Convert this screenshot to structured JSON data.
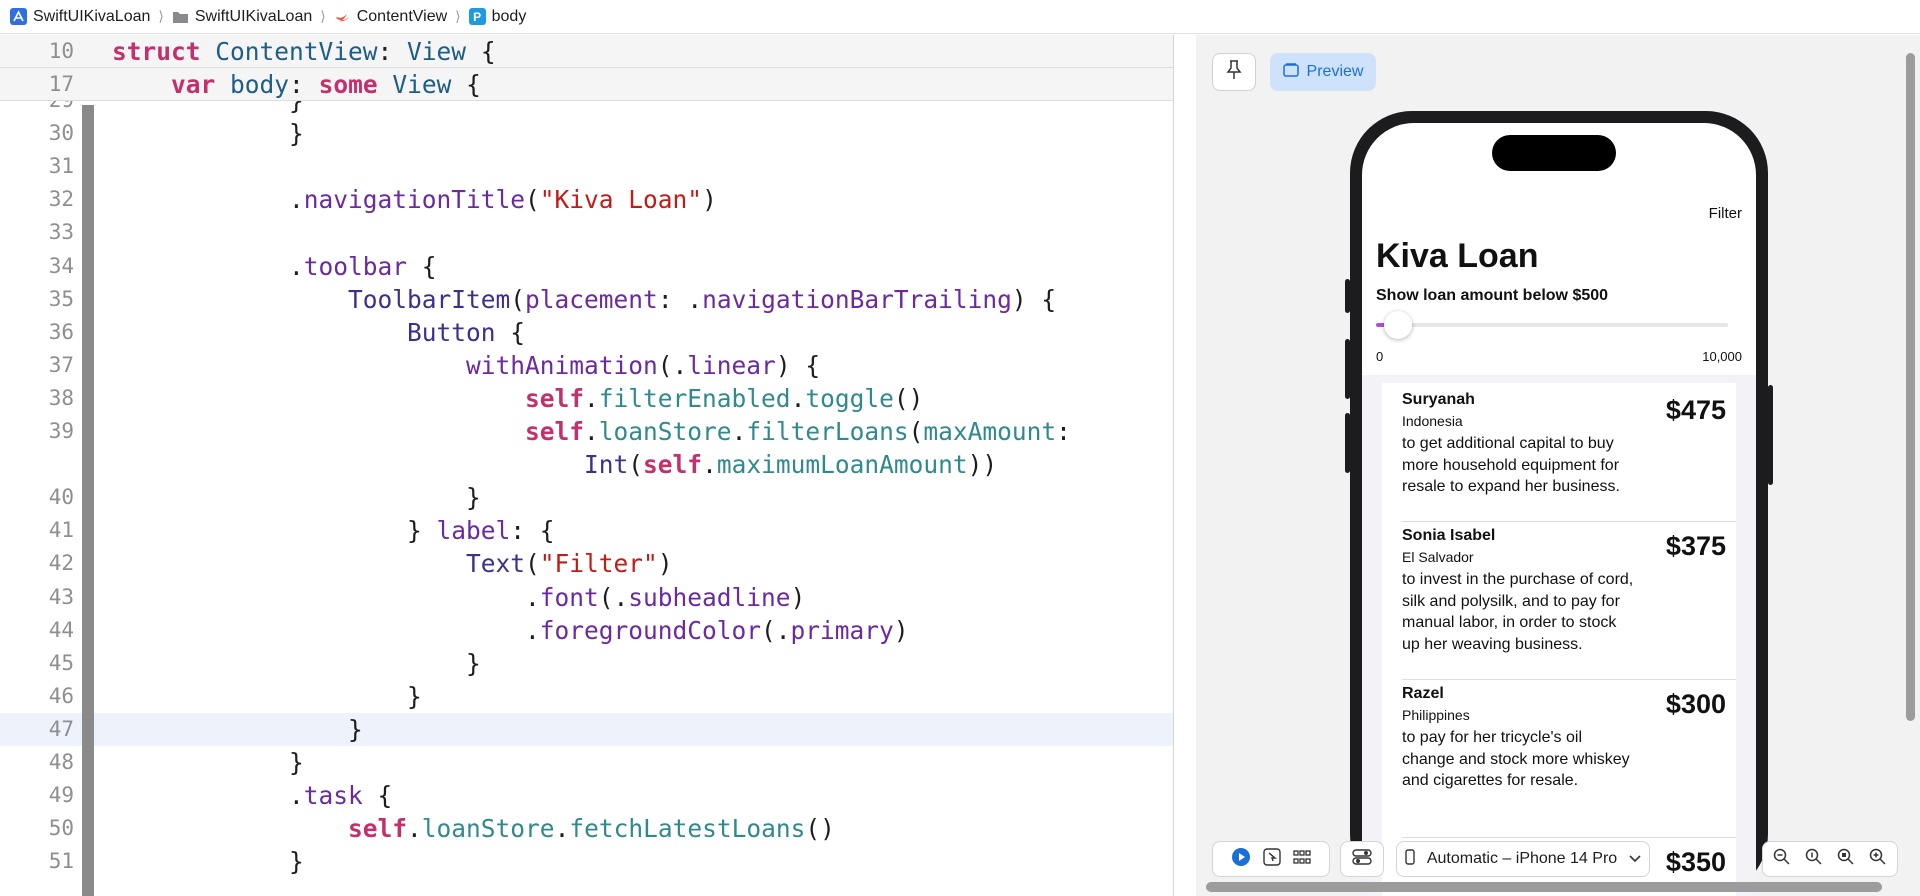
{
  "breadcrumb": {
    "project": "SwiftUIKivaLoan",
    "folder": "SwiftUIKivaLoan",
    "file": "ContentView",
    "symbol": "body",
    "symbol_badge": "P"
  },
  "editor": {
    "sticky_lines": [
      {
        "num": "10",
        "segments": [
          [
            "kw",
            "struct "
          ],
          [
            "ty",
            "ContentView"
          ],
          [
            "plain",
            ": "
          ],
          [
            "ty",
            "View"
          ],
          [
            "plain",
            " {"
          ]
        ]
      },
      {
        "num": "17",
        "segments": [
          [
            "plain",
            "    "
          ],
          [
            "kw",
            "var "
          ],
          [
            "ty",
            "body"
          ],
          [
            "plain",
            ": "
          ],
          [
            "kw",
            "some "
          ],
          [
            "ty",
            "View"
          ],
          [
            "plain",
            " {"
          ]
        ]
      }
    ],
    "lines": [
      {
        "num": "29",
        "segments": [
          [
            "plain",
            "            }"
          ]
        ]
      },
      {
        "num": "30",
        "segments": [
          [
            "plain",
            "            }"
          ]
        ]
      },
      {
        "num": "31",
        "segments": [
          [
            "plain",
            ""
          ]
        ]
      },
      {
        "num": "32",
        "segments": [
          [
            "plain",
            "            ."
          ],
          [
            "fn",
            "navigationTitle"
          ],
          [
            "plain",
            "("
          ],
          [
            "str",
            "\"Kiva Loan\""
          ],
          [
            "plain",
            ")"
          ]
        ]
      },
      {
        "num": "33",
        "segments": [
          [
            "plain",
            ""
          ]
        ]
      },
      {
        "num": "34",
        "segments": [
          [
            "plain",
            "            ."
          ],
          [
            "fn",
            "toolbar"
          ],
          [
            "plain",
            " {"
          ]
        ]
      },
      {
        "num": "35",
        "segments": [
          [
            "plain",
            "                "
          ],
          [
            "tyn",
            "ToolbarItem"
          ],
          [
            "plain",
            "("
          ],
          [
            "fn",
            "placement"
          ],
          [
            "plain",
            ": ."
          ],
          [
            "fn",
            "navigationBarTrailing"
          ],
          [
            "plain",
            ") {"
          ]
        ]
      },
      {
        "num": "36",
        "segments": [
          [
            "plain",
            "                    "
          ],
          [
            "tyn",
            "Button"
          ],
          [
            "plain",
            " {"
          ]
        ]
      },
      {
        "num": "37",
        "segments": [
          [
            "plain",
            "                        "
          ],
          [
            "fn",
            "withAnimation"
          ],
          [
            "plain",
            "(."
          ],
          [
            "fn",
            "linear"
          ],
          [
            "plain",
            ") {"
          ]
        ]
      },
      {
        "num": "38",
        "segments": [
          [
            "plain",
            "                            "
          ],
          [
            "kw",
            "self"
          ],
          [
            "plain",
            "."
          ],
          [
            "prop",
            "filterEnabled"
          ],
          [
            "plain",
            "."
          ],
          [
            "prop",
            "toggle"
          ],
          [
            "plain",
            "()"
          ]
        ]
      },
      {
        "num": "39",
        "segments": [
          [
            "plain",
            "                            "
          ],
          [
            "kw",
            "self"
          ],
          [
            "plain",
            "."
          ],
          [
            "prop",
            "loanStore"
          ],
          [
            "plain",
            "."
          ],
          [
            "prop",
            "filterLoans"
          ],
          [
            "plain",
            "("
          ],
          [
            "prop",
            "maxAmount"
          ],
          [
            "plain",
            ":"
          ]
        ]
      },
      {
        "num": "",
        "segments": [
          [
            "plain",
            "                                "
          ],
          [
            "tyn",
            "Int"
          ],
          [
            "plain",
            "("
          ],
          [
            "kw",
            "self"
          ],
          [
            "plain",
            "."
          ],
          [
            "prop",
            "maximumLoanAmount"
          ],
          [
            "plain",
            "))"
          ]
        ]
      },
      {
        "num": "40",
        "segments": [
          [
            "plain",
            "                        }"
          ]
        ]
      },
      {
        "num": "41",
        "segments": [
          [
            "plain",
            "                    } "
          ],
          [
            "fn",
            "label"
          ],
          [
            "plain",
            ": {"
          ]
        ]
      },
      {
        "num": "42",
        "segments": [
          [
            "plain",
            "                        "
          ],
          [
            "tyn",
            "Text"
          ],
          [
            "plain",
            "("
          ],
          [
            "str",
            "\"Filter\""
          ],
          [
            "plain",
            ")"
          ]
        ]
      },
      {
        "num": "43",
        "segments": [
          [
            "plain",
            "                            ."
          ],
          [
            "fn",
            "font"
          ],
          [
            "plain",
            "(."
          ],
          [
            "fn",
            "subheadline"
          ],
          [
            "plain",
            ")"
          ]
        ]
      },
      {
        "num": "44",
        "segments": [
          [
            "plain",
            "                            ."
          ],
          [
            "fn",
            "foregroundColor"
          ],
          [
            "plain",
            "(."
          ],
          [
            "fn",
            "primary"
          ],
          [
            "plain",
            ")"
          ]
        ]
      },
      {
        "num": "45",
        "segments": [
          [
            "plain",
            "                        }"
          ]
        ]
      },
      {
        "num": "46",
        "segments": [
          [
            "plain",
            "                    }"
          ]
        ]
      },
      {
        "num": "47",
        "segments": [
          [
            "plain",
            "                }"
          ]
        ],
        "highlight": true
      },
      {
        "num": "48",
        "segments": [
          [
            "plain",
            "            }"
          ]
        ]
      },
      {
        "num": "49",
        "segments": [
          [
            "plain",
            "            ."
          ],
          [
            "fn",
            "task"
          ],
          [
            "plain",
            " {"
          ]
        ]
      },
      {
        "num": "50",
        "segments": [
          [
            "plain",
            "                "
          ],
          [
            "kw",
            "self"
          ],
          [
            "plain",
            "."
          ],
          [
            "prop",
            "loanStore"
          ],
          [
            "plain",
            "."
          ],
          [
            "prop",
            "fetchLatestLoans"
          ],
          [
            "plain",
            "()"
          ]
        ]
      },
      {
        "num": "51",
        "segments": [
          [
            "plain",
            "            }"
          ]
        ]
      }
    ]
  },
  "preview": {
    "preview_label": "Preview",
    "device_label": "Automatic – iPhone 14 Pro",
    "app": {
      "toolbar_filter": "Filter",
      "title": "Kiva Loan",
      "slider_caption": "Show loan amount below $500",
      "slider_min": "0",
      "slider_max": "10,000",
      "slider_value_fraction": 0.05,
      "accent": "#b04fe0",
      "loans": [
        {
          "name": "Suryanah",
          "country": "Indonesia",
          "use": "to get additional capital to buy more household equipment for resale to expand her business.",
          "amount": "$475"
        },
        {
          "name": "Sonia Isabel",
          "country": "El Salvador",
          "use": "to invest in the purchase of cord, silk and polysilk, and to pay for manual labor, in order to stock up her weaving business.",
          "amount": "$375"
        },
        {
          "name": "Razel",
          "country": "Philippines",
          "use": "to pay for her tricycle's oil change and stock more whiskey and cigarettes for resale.",
          "amount": "$300"
        },
        {
          "name": "",
          "country": "",
          "use": "",
          "amount": "$350"
        }
      ]
    }
  }
}
